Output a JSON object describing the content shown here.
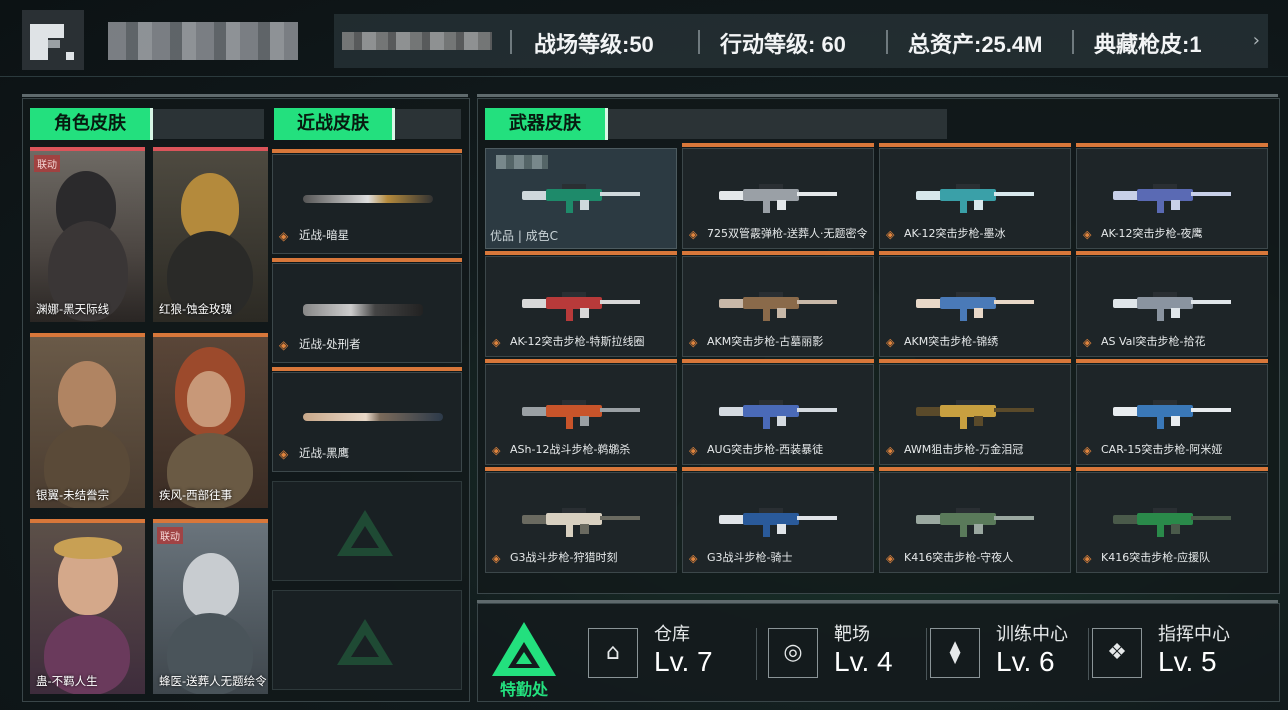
{
  "header": {
    "stats": [
      {
        "label": "战场等级:50"
      },
      {
        "label": "行动等级: 60"
      },
      {
        "label": "总资产:25.4M"
      },
      {
        "label": "典藏枪皮:1"
      }
    ],
    "chevron": "›"
  },
  "sections": {
    "character_title": "角色皮肤",
    "melee_title": "近战皮肤",
    "weapon_title": "武器皮肤"
  },
  "characters": [
    {
      "label": "渊娜-黑天际线",
      "tag": "联动"
    },
    {
      "label": "红狼-蚀金玫瑰",
      "tag": ""
    },
    {
      "label": "银翼-未结誊宗",
      "tag": ""
    },
    {
      "label": "疾风-西部往事",
      "tag": ""
    },
    {
      "label": "蛊-不羁人生",
      "tag": ""
    },
    {
      "label": "蜂医-送葬人无题绘令",
      "tag": "联动"
    }
  ],
  "melee": [
    {
      "label": "近战-暗星"
    },
    {
      "label": "近战-处刑者"
    },
    {
      "label": "近战-黑鹰"
    }
  ],
  "weapons": [
    {
      "label": "",
      "rarity": "优品 | 成色C"
    },
    {
      "label": "725双管霰弹枪-送葬人·无题密令"
    },
    {
      "label": "AK-12突击步枪-墨冰"
    },
    {
      "label": "AK-12突击步枪-夜鹰"
    },
    {
      "label": "AK-12突击步枪-特斯拉线圈"
    },
    {
      "label": "AKM突击步枪-古墓丽影"
    },
    {
      "label": "AKM突击步枪-锦绣"
    },
    {
      "label": "AS Val突击步枪-拾花"
    },
    {
      "label": "ASh-12战斗步枪-鹈鹕杀"
    },
    {
      "label": "AUG突击步枪-西装暴徒"
    },
    {
      "label": "AWM狙击步枪-万金泪冠"
    },
    {
      "label": "CAR-15突击步枪-阿米娅"
    },
    {
      "label": "G3战斗步枪-狩猎时刻"
    },
    {
      "label": "G3战斗步枪-骑士"
    },
    {
      "label": "K416突击步枪-守夜人"
    },
    {
      "label": "K416突击步枪-应援队"
    }
  ],
  "base": {
    "hq_label": "特勤处",
    "facilities": [
      {
        "name": "仓库",
        "level": "Lv. 7",
        "icon": "warehouse-icon"
      },
      {
        "name": "靶场",
        "level": "Lv. 4",
        "icon": "target-icon"
      },
      {
        "name": "训练中心",
        "level": "Lv. 6",
        "icon": "dumbbell-icon"
      },
      {
        "name": "指挥中心",
        "level": "Lv. 5",
        "icon": "command-icon"
      }
    ]
  },
  "colors": {
    "accent": "#23e07e",
    "card_bar_orange": "#d8773a",
    "card_bar_red": "#d9545a"
  }
}
